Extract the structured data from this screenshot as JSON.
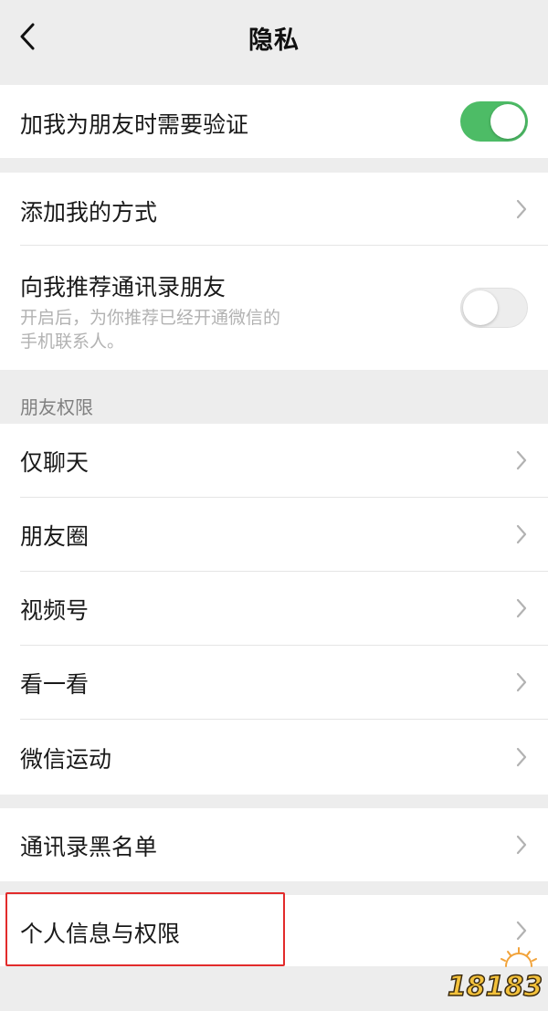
{
  "nav": {
    "title": "隐私",
    "back_icon": "chevron-left-icon"
  },
  "rows": {
    "verify": {
      "label": "加我为朋友时需要验证",
      "toggle_on": true
    },
    "add_me": {
      "label": "添加我的方式"
    },
    "recommend": {
      "label": "向我推荐通讯录朋友",
      "sub_line1": "开启后，为你推荐已经开通微信的",
      "sub_line2": "手机联系人。",
      "toggle_on": false
    },
    "friend_perm_header": "朋友权限",
    "chat_only": {
      "label": "仅聊天"
    },
    "moments": {
      "label": "朋友圈"
    },
    "channels": {
      "label": "视频号"
    },
    "top_stories": {
      "label": "看一看"
    },
    "werun": {
      "label": "微信运动"
    },
    "blacklist": {
      "label": "通讯录黑名单"
    },
    "personal_info": {
      "label": "个人信息与权限"
    }
  },
  "watermark": {
    "text": "18183"
  },
  "colors": {
    "toggle_on": "#4dbc66",
    "highlight_border": "#e22b2b",
    "background": "#ededed"
  }
}
